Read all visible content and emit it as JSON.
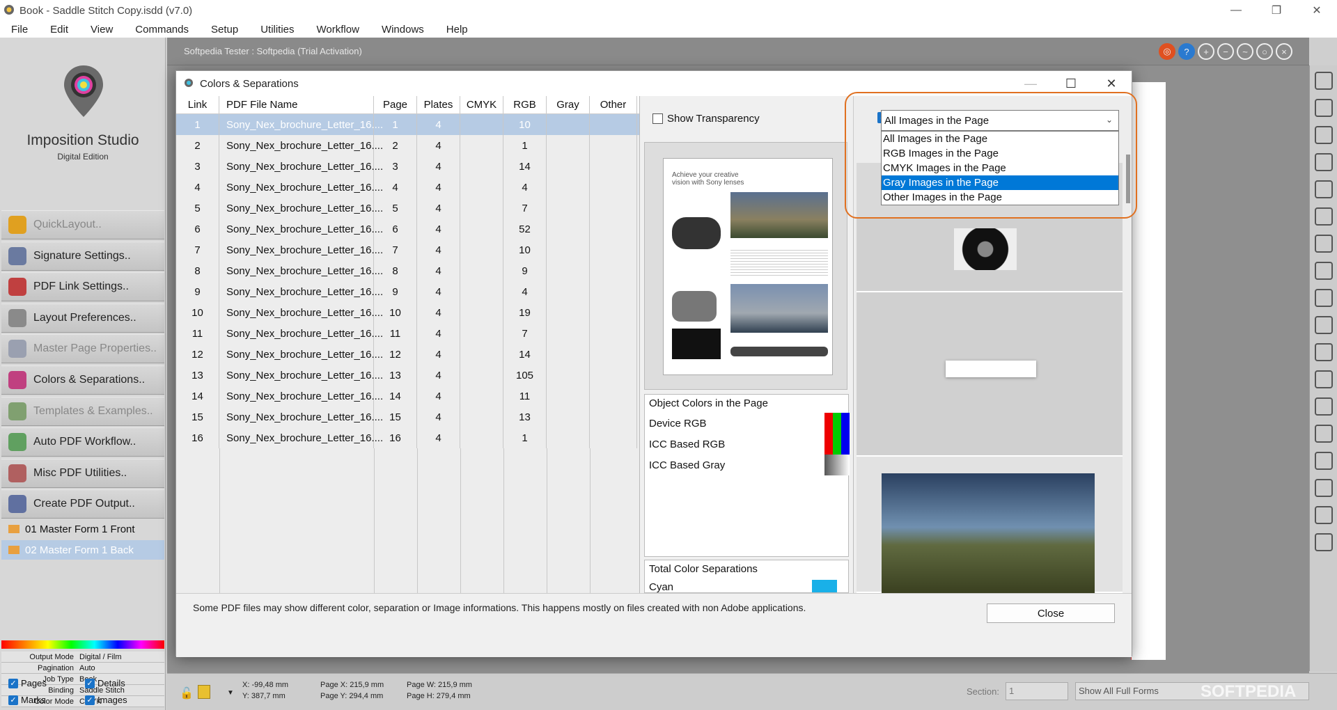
{
  "window": {
    "title": "Book - Saddle Stitch Copy.isdd (v7.0)"
  },
  "menu": [
    "File",
    "Edit",
    "View",
    "Commands",
    "Setup",
    "Utilities",
    "Workflow",
    "Windows",
    "Help"
  ],
  "logo": {
    "name": "Imposition Studio",
    "edition": "Digital Edition"
  },
  "sidebar": {
    "items": [
      {
        "label": "QuickLayout..",
        "disabled": true,
        "color": "#e0a020"
      },
      {
        "label": "Signature Settings..",
        "disabled": false,
        "color": "#6a7aa0"
      },
      {
        "label": "PDF Link Settings..",
        "disabled": false,
        "color": "#c04040"
      },
      {
        "label": "Layout Preferences..",
        "disabled": false,
        "color": "#8a8a8a"
      },
      {
        "label": "Master Page Properties..",
        "disabled": true,
        "color": "#9aa0b0"
      },
      {
        "label": "Colors & Separations..",
        "disabled": false,
        "color": "#c04080"
      },
      {
        "label": "Templates & Examples..",
        "disabled": true,
        "color": "#80a070"
      },
      {
        "label": "Auto PDF Workflow..",
        "disabled": false,
        "color": "#60a060"
      },
      {
        "label": "Misc PDF Utilities..",
        "disabled": false,
        "color": "#b06060"
      },
      {
        "label": "Create PDF Output..",
        "disabled": false,
        "color": "#6070a0"
      }
    ]
  },
  "forms": [
    {
      "label": "01 Master Form 1 Front",
      "selected": false
    },
    {
      "label": "02 Master Form 1 Back",
      "selected": true
    }
  ],
  "properties": [
    {
      "k": "Output Mode",
      "v": "Digital / Film"
    },
    {
      "k": "Pagination",
      "v": "Auto"
    },
    {
      "k": "Job Type",
      "v": "Book"
    },
    {
      "k": "Binding",
      "v": "Saddle Stitch"
    },
    {
      "k": "Color Mode",
      "v": "CMYK"
    }
  ],
  "checks": {
    "pages": "Pages",
    "details": "Details",
    "marks": "Marks",
    "images": "Images"
  },
  "workspace": {
    "tester": "Softpedia Tester : Softpedia (Trial Activation)"
  },
  "status": {
    "x": "X: -99,48 mm",
    "y": "Y: 387,7 mm",
    "pagex": "Page X: 215,9 mm",
    "pagey": "Page Y: 294,4 mm",
    "pagew": "Page W: 215,9 mm",
    "pageh": "Page H: 279,4 mm",
    "section_label": "Section:",
    "section_value": "1",
    "show": "Show All Full Forms",
    "watermark": "SOFTPEDIA"
  },
  "dialog": {
    "title": "Colors & Separations",
    "columns": [
      "Link",
      "PDF File Name",
      "Page",
      "Plates",
      "CMYK",
      "RGB",
      "Gray",
      "Other"
    ],
    "rows": [
      [
        "1",
        "Sony_Nex_brochure_Letter_16....",
        "1",
        "4",
        "",
        "10",
        "",
        ""
      ],
      [
        "2",
        "Sony_Nex_brochure_Letter_16....",
        "2",
        "4",
        "",
        "1",
        "",
        ""
      ],
      [
        "3",
        "Sony_Nex_brochure_Letter_16....",
        "3",
        "4",
        "",
        "14",
        "",
        ""
      ],
      [
        "4",
        "Sony_Nex_brochure_Letter_16....",
        "4",
        "4",
        "",
        "4",
        "",
        ""
      ],
      [
        "5",
        "Sony_Nex_brochure_Letter_16....",
        "5",
        "4",
        "",
        "7",
        "",
        ""
      ],
      [
        "6",
        "Sony_Nex_brochure_Letter_16....",
        "6",
        "4",
        "",
        "52",
        "",
        ""
      ],
      [
        "7",
        "Sony_Nex_brochure_Letter_16....",
        "7",
        "4",
        "",
        "10",
        "",
        ""
      ],
      [
        "8",
        "Sony_Nex_brochure_Letter_16....",
        "8",
        "4",
        "",
        "9",
        "",
        ""
      ],
      [
        "9",
        "Sony_Nex_brochure_Letter_16....",
        "9",
        "4",
        "",
        "4",
        "",
        ""
      ],
      [
        "10",
        "Sony_Nex_brochure_Letter_16....",
        "10",
        "4",
        "",
        "19",
        "",
        ""
      ],
      [
        "11",
        "Sony_Nex_brochure_Letter_16....",
        "11",
        "4",
        "",
        "7",
        "",
        ""
      ],
      [
        "12",
        "Sony_Nex_brochure_Letter_16....",
        "12",
        "4",
        "",
        "14",
        "",
        ""
      ],
      [
        "13",
        "Sony_Nex_brochure_Letter_16....",
        "13",
        "4",
        "",
        "105",
        "",
        ""
      ],
      [
        "14",
        "Sony_Nex_brochure_Letter_16....",
        "14",
        "4",
        "",
        "11",
        "",
        ""
      ],
      [
        "15",
        "Sony_Nex_brochure_Letter_16....",
        "15",
        "4",
        "",
        "13",
        "",
        ""
      ],
      [
        "16",
        "Sony_Nex_brochure_Letter_16....",
        "16",
        "4",
        "",
        "1",
        "",
        ""
      ]
    ],
    "selected_row": 0,
    "show_transparency": "Show Transparency",
    "thumb_headline": "Achieve your creative vision with Sony lenses",
    "object_colors": {
      "title": "Object Colors in the Page",
      "items": [
        "Device RGB",
        "ICC Based RGB",
        "ICC Based Gray"
      ]
    },
    "separations": {
      "title": "Total Color Separations",
      "items": [
        "Cyan"
      ]
    },
    "image_filter": {
      "selected": "All Images in the Page",
      "options": [
        "All Images in the Page",
        "RGB Images in the Page",
        "CMYK Images in the Page",
        "Gray Images in the Page",
        "Other Images in the Page"
      ],
      "highlighted": 3
    },
    "footer_message": "Some PDF files may show different color, separation or Image informations. This happens mostly on files created with non Adobe applications.",
    "close_label": "Close"
  },
  "colors": {
    "accent": "#0078d7",
    "highlight_ring": "#e07020",
    "selected_row": "#b6cbe4"
  }
}
